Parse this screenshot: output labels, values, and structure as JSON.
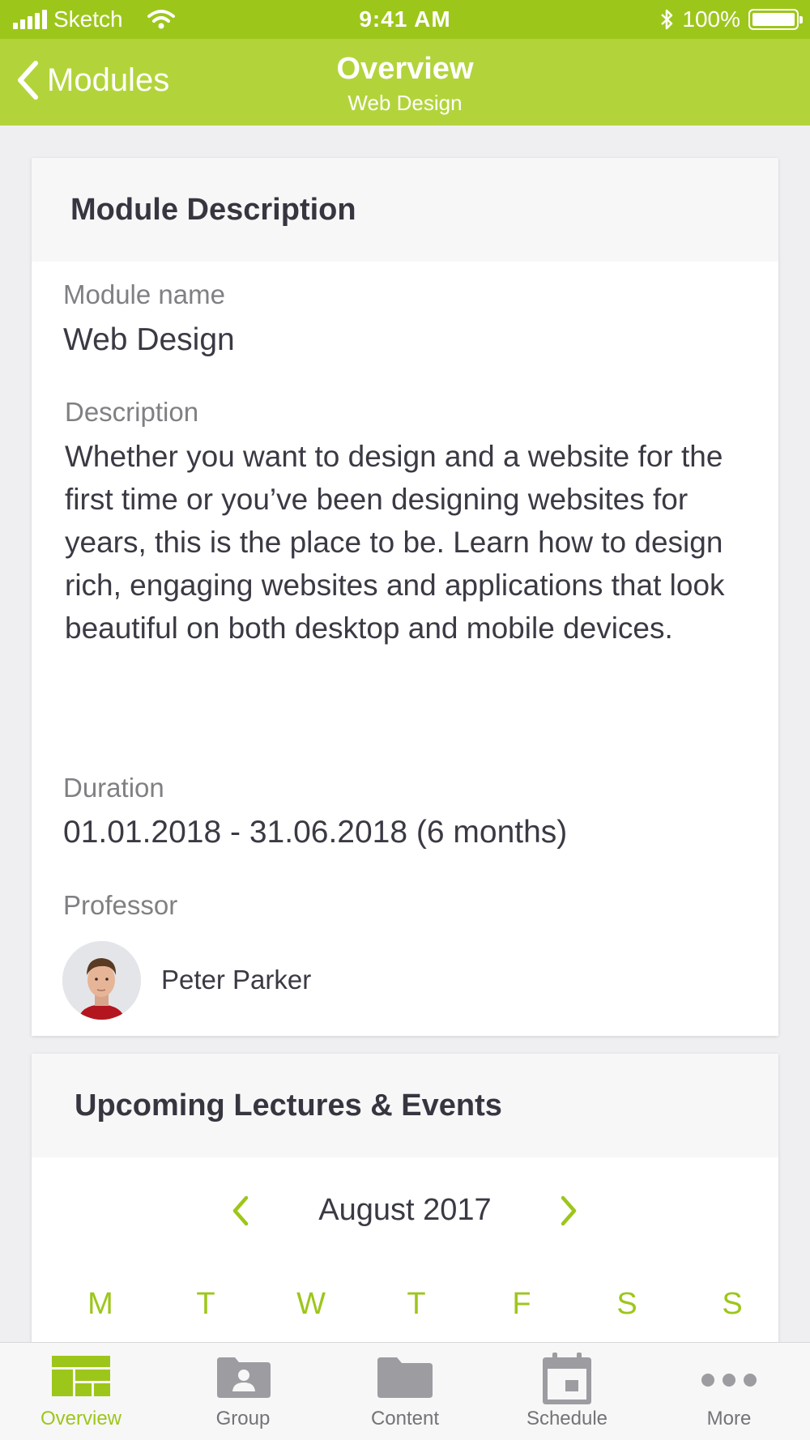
{
  "status_bar": {
    "carrier": "Sketch",
    "time": "9:41 AM",
    "battery": "100%"
  },
  "nav": {
    "back_label": "Modules",
    "title": "Overview",
    "subtitle": "Web Design"
  },
  "module": {
    "header": "Module Description",
    "name_label": "Module name",
    "name_value": "Web Design",
    "description_label": "Description",
    "description_value": "Whether you want to design and a website for the first time or you’ve been designing websites for years, this is the place to be. Learn how to design rich, engaging websites and applications that look beautiful on both desktop and mobile devices.",
    "duration_label": "Duration",
    "duration_value": "01.01.2018 - 31.06.2018 (6 months)",
    "professor_label": "Professor",
    "professor_name": "Peter Parker"
  },
  "events": {
    "header": "Upcoming Lectures & Events",
    "month": "August 2017",
    "weekdays": [
      "M",
      "T",
      "W",
      "T",
      "F",
      "S",
      "S"
    ]
  },
  "tabs": [
    {
      "label": "Overview",
      "icon": "overview-icon",
      "active": true
    },
    {
      "label": "Group",
      "icon": "group-icon",
      "active": false
    },
    {
      "label": "Content",
      "icon": "folder-icon",
      "active": false
    },
    {
      "label": "Schedule",
      "icon": "calendar-icon",
      "active": false
    },
    {
      "label": "More",
      "icon": "more-icon",
      "active": false
    }
  ],
  "colors": {
    "accent": "#9dc61b",
    "nav_background": "#b2d43a",
    "inactive_icon": "#9c9ca1"
  }
}
